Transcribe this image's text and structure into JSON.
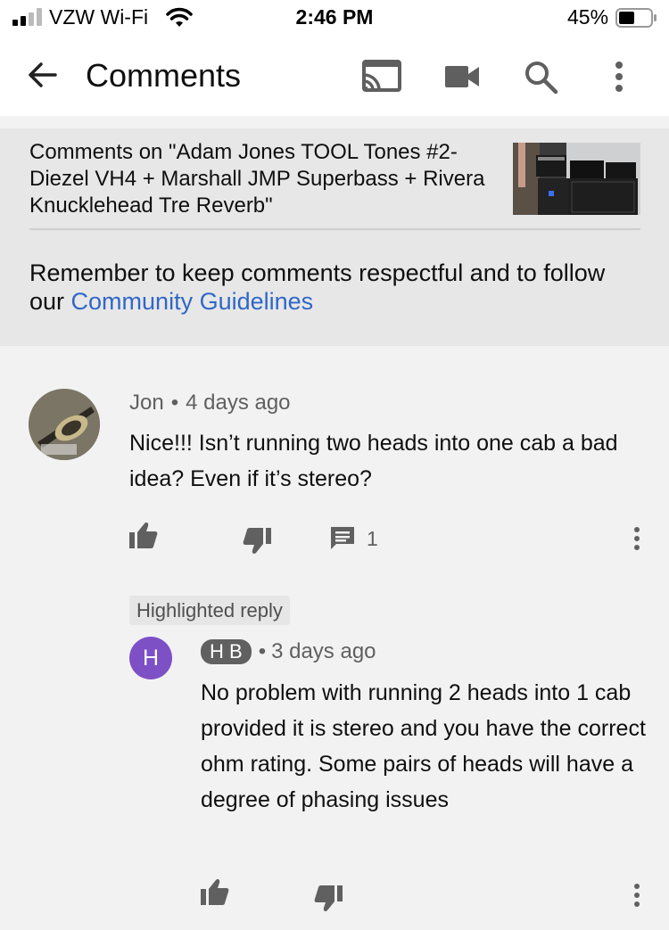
{
  "status_bar": {
    "carrier": "VZW Wi-Fi",
    "time": "2:46 PM",
    "battery": "45%"
  },
  "app_bar": {
    "title": "Comments",
    "icons": [
      "back-arrow-icon",
      "cast-icon",
      "video-camera-icon",
      "search-icon",
      "more-vert-icon"
    ]
  },
  "video": {
    "comments_on": "Comments on \"Adam Jones TOOL Tones #2- Diezel VH4 + Marshall JMP Superbass + Rivera Knucklehead Tre Reverb\"",
    "guidelines_text": "Remember to keep comments respectful and to follow our",
    "guidelines_link": "Community Guidelines"
  },
  "comments": [
    {
      "author": "Jon",
      "time": "4 days ago",
      "text": "Nice!!! Isn’t running two heads into one cab a bad idea? Even if it’s stereo?",
      "reply_count": "1"
    }
  ],
  "reply": {
    "chip": "Highlighted reply",
    "avatar_letter": "H",
    "author": "H B",
    "time": "3 days ago",
    "text": "No problem with running 2 heads into 1 cab provided it is stereo and you have the correct ohm rating. Some pairs of heads will have a degree of phasing issues"
  },
  "colors": {
    "link": "#2f67c8",
    "avatar_purple": "#7d50c6",
    "secondary_text": "#606060"
  }
}
